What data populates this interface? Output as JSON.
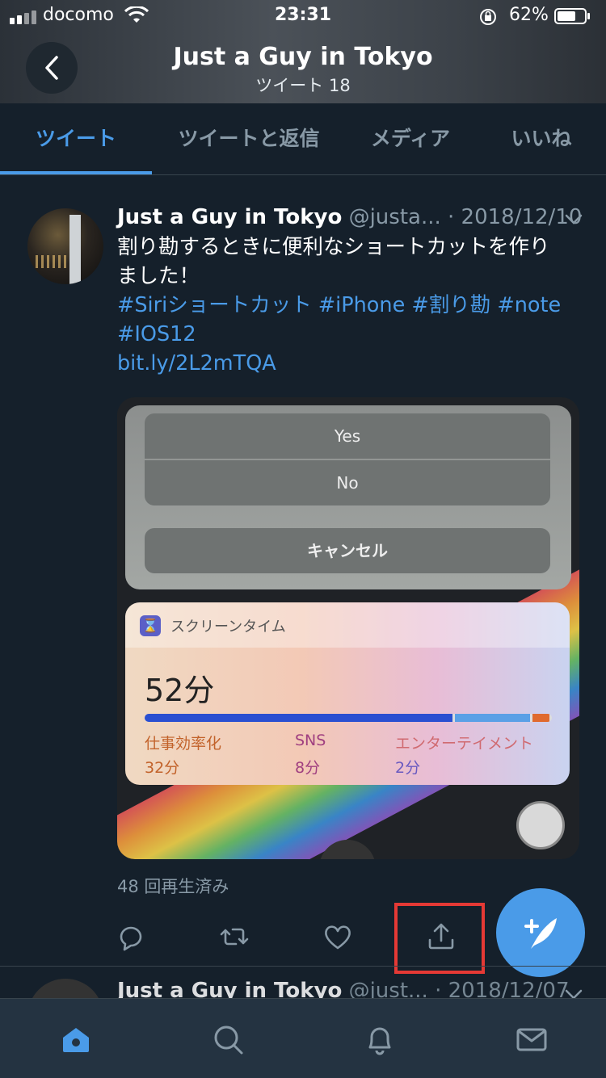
{
  "status_bar": {
    "carrier": "docomo",
    "time": "23:31",
    "battery_percent": "62%"
  },
  "header": {
    "title": "Just a Guy in Tokyo",
    "subtitle": "ツイート 18"
  },
  "tabs": [
    {
      "label": "ツイート",
      "active": true
    },
    {
      "label": "ツイートと返信",
      "active": false
    },
    {
      "label": "メディア",
      "active": false
    },
    {
      "label": "いいね",
      "active": false
    }
  ],
  "tweet": {
    "name": "Just a Guy in Tokyo",
    "handle": "@justa...",
    "separator": " · ",
    "date": "2018/12/10",
    "text_line1": "割り勘するときに便利なショートカットを作り",
    "text_line2": "ました！",
    "hashtags_line1": "#Siriショートカット #iPhone #割り勘 #note",
    "hashtags_line2": "#IOS12",
    "link": "bit.ly/2L2mTQA",
    "view_count": "48 回再生済み",
    "media": {
      "alert_yes": "Yes",
      "alert_no": "No",
      "alert_cancel": "キャンセル",
      "widget_title": "スクリーンタイム",
      "widget_total": "52分",
      "categories": [
        {
          "label": "仕事効率化",
          "value": "32分",
          "minutes": 32,
          "color": "#2a4fd1"
        },
        {
          "label": "SNS",
          "value": "8分",
          "minutes": 8,
          "color": "#5aa0e6"
        },
        {
          "label": "エンターテイメント",
          "value": "2分",
          "minutes": 2,
          "color": "#e06a2e"
        }
      ]
    }
  },
  "next_tweet": {
    "name": "Just a Guy in Tokyo",
    "handle": "@just...",
    "separator": " · ",
    "date": "2018/12/07"
  },
  "colors": {
    "accent": "#4a9be8",
    "background": "#15202b",
    "highlight": "#e53935"
  },
  "icons": {
    "reply": "reply-icon",
    "retweet": "retweet-icon",
    "like": "heart-icon",
    "share": "share-icon",
    "compose": "compose-icon",
    "nav": [
      "home-icon",
      "search-icon",
      "notifications-icon",
      "messages-icon"
    ]
  }
}
